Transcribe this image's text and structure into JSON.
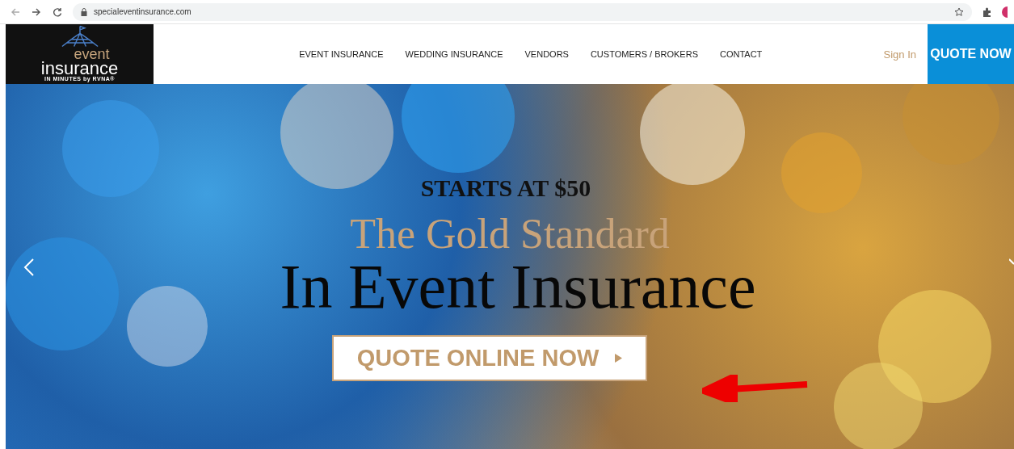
{
  "browser": {
    "url": "specialeventinsurance.com"
  },
  "logo": {
    "line_1": "event",
    "line_2": "insurance",
    "tagline": "IN MINUTES by RVNA®"
  },
  "nav": {
    "items": [
      {
        "label": "EVENT INSURANCE"
      },
      {
        "label": "WEDDING INSURANCE"
      },
      {
        "label": "VENDORS"
      },
      {
        "label": "CUSTOMERS / BROKERS"
      },
      {
        "label": "CONTACT"
      }
    ],
    "sign_in": "Sign In",
    "cta": "QUOTE NOW"
  },
  "hero": {
    "eyebrow": "STARTS AT $50",
    "subtitle": "The Gold Standard",
    "title": "In Event Insurance",
    "button": "QUOTE ONLINE NOW"
  }
}
